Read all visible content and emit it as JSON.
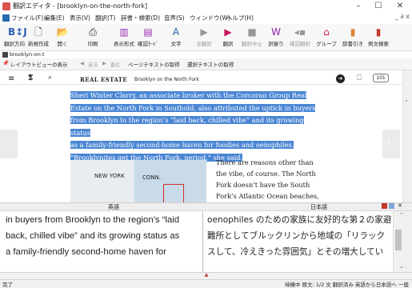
{
  "window": {
    "title": "翻訳エディタ - [brooklyn-on-the-north-fork]",
    "min_icon": "minimize-icon",
    "max_icon": "maximize-icon",
    "close_icon": "close-icon"
  },
  "menu": {
    "items": [
      "ファイル(F)",
      "編集(E)",
      "表示(V)",
      "翻訳(T)",
      "辞書・検索(D)",
      "音声(S)",
      "ウィンドウ(W)",
      "ヘルプ(H)"
    ],
    "right": "_ ∂ x"
  },
  "toolbar": {
    "buttons": [
      {
        "label": "翻訳方向",
        "icon": "direction-icon"
      },
      {
        "label": "新規作成",
        "icon": "new-doc-icon"
      },
      {
        "label": "開く",
        "icon": "open-folder-icon"
      },
      {
        "label": "印刷",
        "icon": "print-icon"
      },
      {
        "label": "表示形式",
        "icon": "layout-icon"
      },
      {
        "label": "確認ﾓｰﾄﾞ",
        "icon": "confirm-mode-icon"
      },
      {
        "label": "文字",
        "icon": "font-icon"
      },
      {
        "label": "全翻訳",
        "icon": "translate-all-icon"
      },
      {
        "label": "翻訳",
        "icon": "translate-icon"
      },
      {
        "label": "翻訳中止",
        "icon": "stop-icon"
      },
      {
        "label": "訳振り",
        "icon": "annotate-icon"
      },
      {
        "label": "確認翻訳",
        "icon": "confirm-translate-icon"
      },
      {
        "label": "グループ",
        "icon": "group-icon"
      },
      {
        "label": "辞書引き",
        "icon": "dictionary-icon"
      },
      {
        "label": "例文検索",
        "icon": "example-search-icon"
      }
    ]
  },
  "doc_tab": "brooklyn-on-t",
  "layout_bar": {
    "preview": "レイアウトビューの表示",
    "back": "戻る",
    "forward": "進む",
    "get_page_text": "ページテキストの取得",
    "get_selection_text": "選択テキストの取得"
  },
  "web": {
    "brand": "REAL ESTATE",
    "headline": "Brooklyn on the North Fork",
    "count": "101",
    "selected_lines": [
      "Sheri Winter Clarry, an associate broker with the Corcoran Group Real",
      "Estate on the North Fork in Southold, also attributed the uptick in buyers",
      "from Brooklyn to the region’s “laid back, chilled vibe” and its growing status",
      "as a family-friendly second-home haven for foodies and oenophiles.",
      "“Brooklynites get the North Fork, period,” she said."
    ],
    "map_labels": [
      "NEW YORK",
      "CONN."
    ],
    "body_lines": [
      "There are reasons other than",
      "the vibe, of course. The North",
      "Fork doesn’t have the South",
      "Fork’s Atlantic Ocean beaches,"
    ]
  },
  "panes": {
    "en_header": "英語",
    "ja_header": "日本語",
    "en_lines": [
      "in buyers from Brooklyn to the region’s “laid",
      "back, chilled vibe” and its growing status as",
      "a family-friendly second-home haven for"
    ],
    "ja_lines": [
      "oenophiles のための家族に友好的な第２の家避",
      "難所としてブルックリンから地域の「リラック",
      "スして、冷えきった雰囲気」とその増大してい"
    ]
  },
  "status": {
    "left": "完了",
    "right": "待機中 原文: 1/2 文 翻訳済み 英語から日本語へ 一般"
  },
  "colors": {
    "selection": "#4a86d4",
    "title_icon": "#d9534f"
  }
}
